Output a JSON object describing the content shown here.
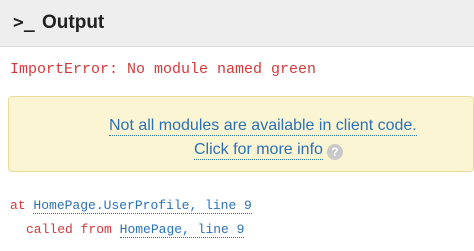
{
  "header": {
    "icon": "terminal-prompt-icon",
    "icon_glyph": ">_",
    "title": "Output"
  },
  "error": {
    "message": "ImportError: No module named green"
  },
  "notice": {
    "line1": "Not all modules are available in client code.",
    "line2": "Click for more info",
    "help_icon": "help-question-icon",
    "help_glyph": "?"
  },
  "traceback": [
    {
      "prefix": "at",
      "location": "HomePage.UserProfile, line 9"
    },
    {
      "prefix": "called from",
      "location": "HomePage, line 9"
    }
  ],
  "colors": {
    "error_red": "#d23a3a",
    "link_blue": "#2a72b8",
    "notice_bg": "#fbf5d3",
    "notice_border": "#eadb9c",
    "header_bg": "#eeeeee"
  }
}
